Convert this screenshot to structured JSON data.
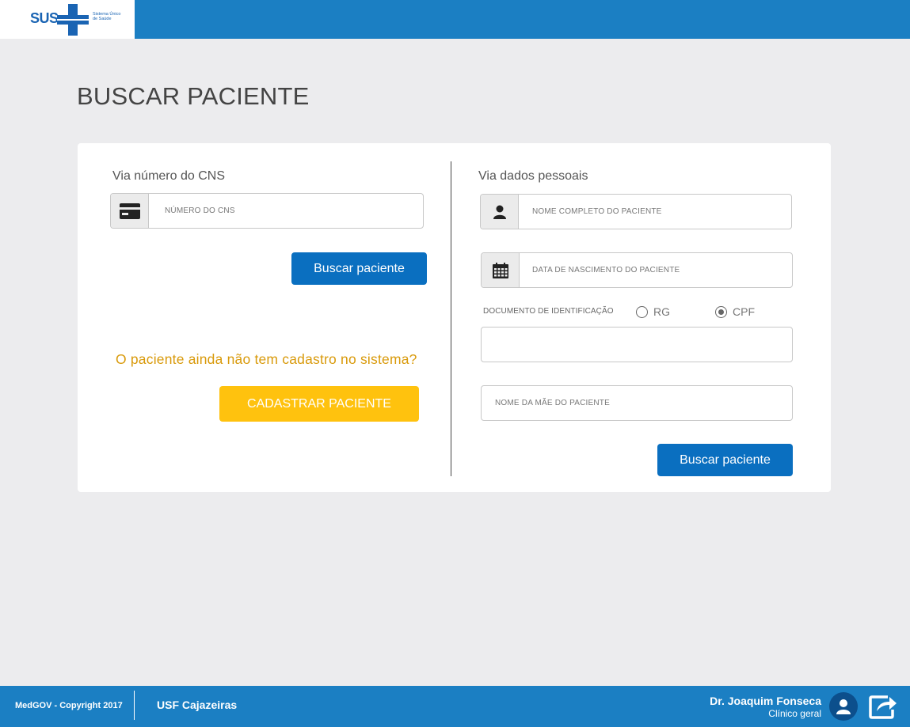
{
  "header": {
    "logo_sus": "SUS",
    "logo_subtitle": "Sistema Único de Saúde"
  },
  "page": {
    "title": "BUSCAR PACIENTE"
  },
  "cns_section": {
    "label": "Via número do CNS",
    "cns_placeholder": "NÚMERO DO CNS",
    "search_button": "Buscar paciente",
    "no_record_question": "O paciente ainda não tem cadastro no sistema?",
    "register_button": "CADASTRAR PACIENTE"
  },
  "personal_section": {
    "label": "Via dados pessoais",
    "name_placeholder": "NOME COMPLETO DO PACIENTE",
    "birthdate_placeholder": "DATA DE NASCIMENTO DO PACIENTE",
    "document_label": "DOCUMENTO DE IDENTIFICAÇÃO",
    "document_options": [
      {
        "label": "RG",
        "selected": false
      },
      {
        "label": "CPF",
        "selected": true
      }
    ],
    "document_value": "",
    "mother_placeholder": "NOME DA MÃE DO PACIENTE",
    "search_button": "Buscar paciente"
  },
  "footer": {
    "copyright": "MedGOV - Copyright 2017",
    "unit": "USF Cajazeiras",
    "user_name": "Dr. Joaquim Fonseca",
    "user_role": "Clínico geral"
  },
  "icons": {
    "cns": "credit-card-icon",
    "name": "user-icon",
    "birthdate": "calendar-icon",
    "avatar": "user-avatar-icon",
    "logout": "logout-share-icon"
  },
  "colors": {
    "primary_blue": "#1b7fc3",
    "button_blue": "#0a6fc0",
    "accent_yellow": "#ffc20e",
    "question_orange": "#d99a0b",
    "background": "#ececee"
  }
}
